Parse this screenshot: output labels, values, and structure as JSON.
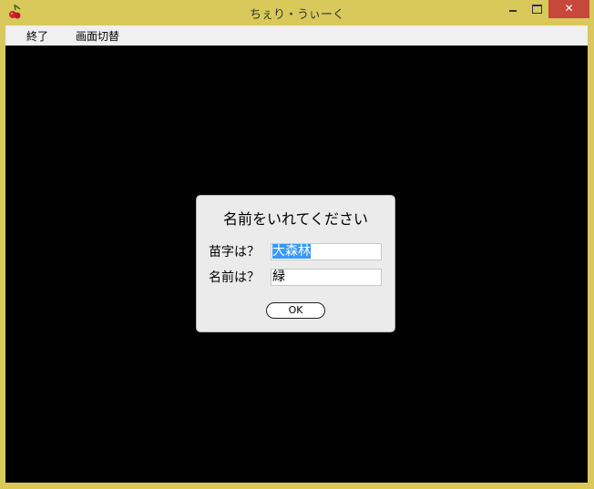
{
  "window": {
    "title": "ちぇり・うぃーく",
    "icon": "cherry-icon",
    "controls": {
      "minimize": "minimize-icon",
      "maximize": "maximize-icon",
      "close_label": "✕"
    },
    "frame_color": "#d8c95a",
    "close_color": "#c7473b"
  },
  "menu": {
    "items": [
      {
        "label": "終了"
      },
      {
        "label": "画面切替"
      }
    ]
  },
  "dialog": {
    "title": "名前をいれてください",
    "surname_label": "苗字は？",
    "surname_value": "大森林",
    "name_label": "名前は？",
    "name_value": "緑",
    "ok_label": "OK",
    "selection_color": "#3399ff"
  }
}
